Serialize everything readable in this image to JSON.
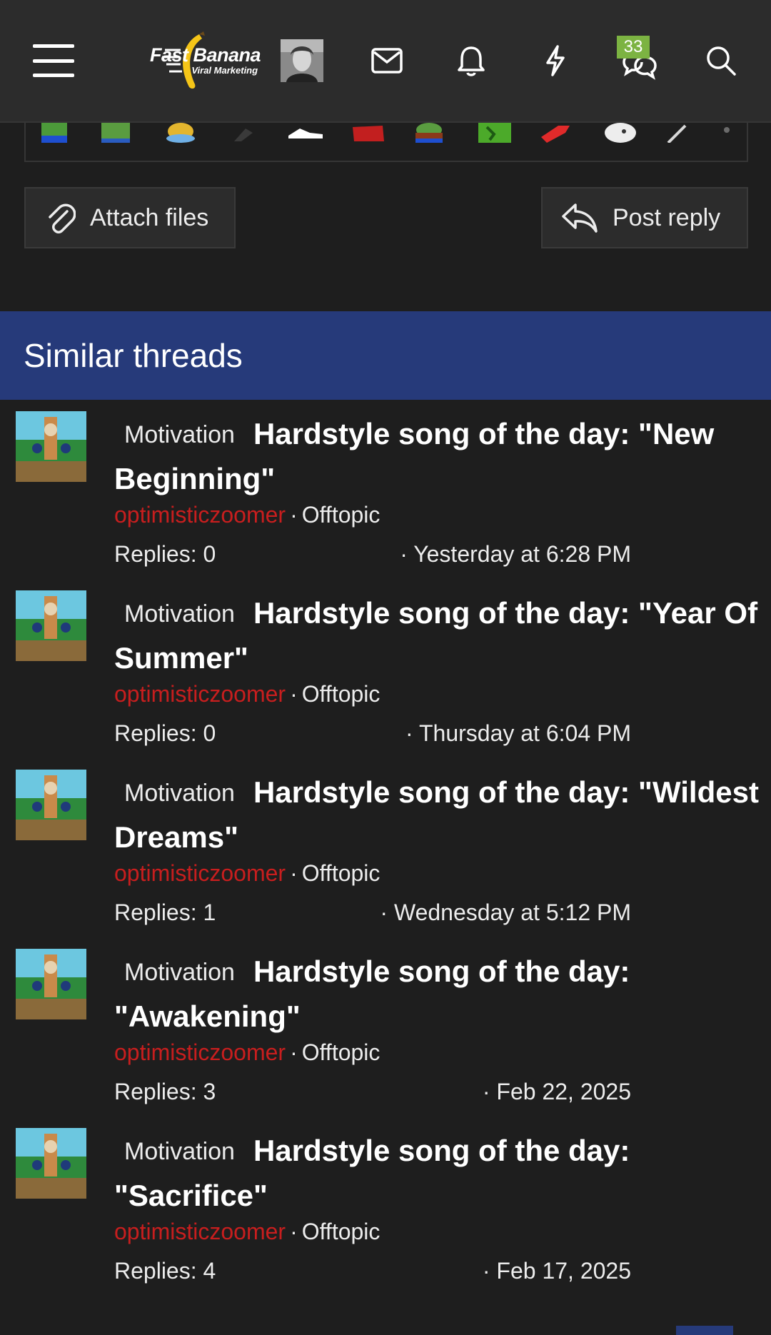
{
  "header": {
    "logo": {
      "name": "Fast Banana",
      "tagline": "Viral Marketing"
    },
    "conversations_badge": "33",
    "icons": [
      "menu-icon",
      "mail-icon",
      "bell-icon",
      "lightning-icon",
      "conversations-icon",
      "search-icon"
    ]
  },
  "actions": {
    "attach_label": "Attach files",
    "reply_label": "Post reply"
  },
  "similar_threads": {
    "heading": "Similar threads",
    "items": [
      {
        "prefix": "Motivation",
        "title": "Hardstyle song of the day: \"New Beginning\"",
        "author": "optimisticzoomer",
        "separator": "·",
        "forum": "Offtopic",
        "replies": "Replies: 0",
        "date": "· Yesterday at 6:28 PM"
      },
      {
        "prefix": "Motivation",
        "title": "Hardstyle song of the day: \"Year Of Summer\"",
        "author": "optimisticzoomer",
        "separator": "·",
        "forum": "Offtopic",
        "replies": "Replies: 0",
        "date": "· Thursday at 6:04 PM"
      },
      {
        "prefix": "Motivation",
        "title": "Hardstyle song of the day: \"Wildest Dreams\"",
        "author": "optimisticzoomer",
        "separator": "·",
        "forum": "Offtopic",
        "replies": "Replies: 1",
        "date": "· Wednesday at 5:12 PM"
      },
      {
        "prefix": "Motivation",
        "title": "Hardstyle song of the day: \"Awakening\"",
        "author": "optimisticzoomer",
        "separator": "·",
        "forum": "Offtopic",
        "replies": "Replies: 3",
        "date": "· Feb 22, 2025"
      },
      {
        "prefix": "Motivation",
        "title": "Hardstyle song of the day: \"Sacrifice\"",
        "author": "optimisticzoomer",
        "separator": "·",
        "forum": "Offtopic",
        "replies": "Replies: 4",
        "date": "· Feb 17, 2025"
      }
    ]
  },
  "colors": {
    "background": "#1e1e1e",
    "header_bg": "#2c2c2c",
    "section_accent": "#263a7a",
    "author": "#c81e1e",
    "badge": "#7cb342",
    "logo_banana": "#f5c518"
  }
}
